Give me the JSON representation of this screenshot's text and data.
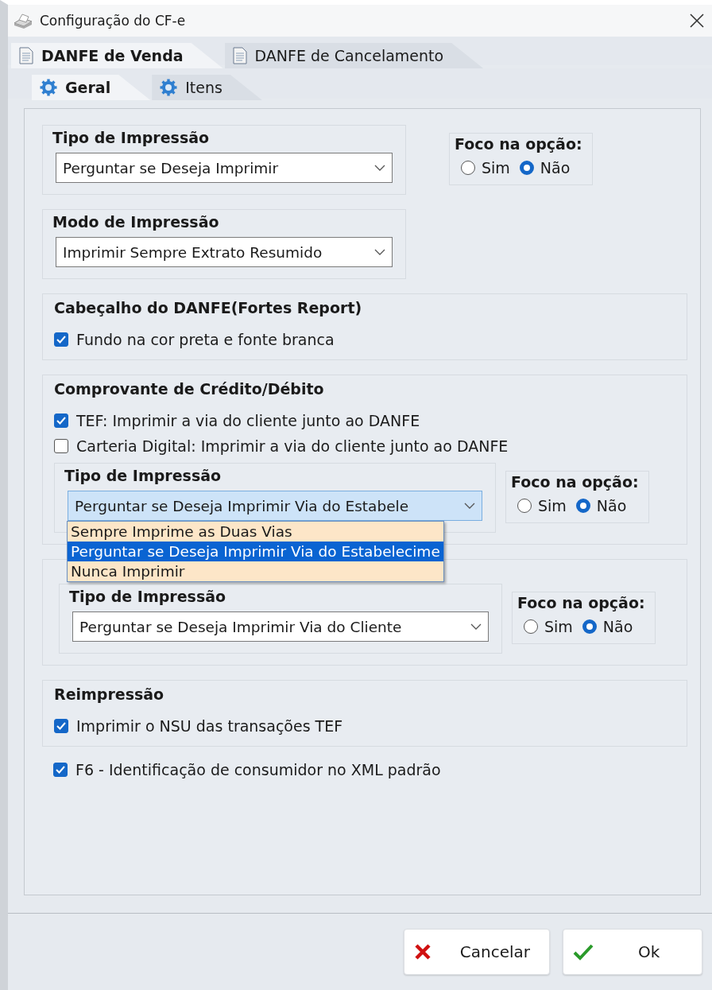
{
  "window": {
    "title": "Configuração do CF-e"
  },
  "tabs": [
    {
      "label": "DANFE de Venda",
      "selected": true
    },
    {
      "label": "DANFE de Cancelamento",
      "selected": false
    }
  ],
  "subtabs": [
    {
      "label": "Geral",
      "selected": true
    },
    {
      "label": "Itens",
      "selected": false
    }
  ],
  "sections": [
    {
      "kind": "row",
      "row": {
        "title": "Tipo de Impressão",
        "select": {
          "value": "Perguntar se Deseja Imprimir",
          "focused": false
        },
        "focus": {
          "title": "Foco na opção:",
          "options": [
            {
              "label": "Sim",
              "selected": false
            },
            {
              "label": "Não",
              "selected": true
            }
          ]
        }
      }
    },
    {
      "kind": "row",
      "row": {
        "title": "Modo de Impressão",
        "select": {
          "value": "Imprimir Sempre Extrato Resumido",
          "focused": false
        }
      }
    },
    {
      "kind": "group",
      "title": "Cabeçalho do DANFE(Fortes Report)",
      "checks": [
        {
          "label": "Fundo na cor preta e fonte branca",
          "checked": true
        }
      ]
    },
    {
      "kind": "group",
      "title": "Comprovante de Crédito/Débito",
      "checks": [
        {
          "label": "TEF: Imprimir a via do cliente junto ao DANFE",
          "checked": true
        },
        {
          "label": "Carteria Digital: Imprimir a via do cliente junto ao DANFE",
          "checked": false
        }
      ],
      "row": {
        "title": "Tipo de Impressão",
        "select": {
          "value": "Perguntar se Deseja Imprimir Via do Estabele",
          "focused": true,
          "options": [
            {
              "label": "Sempre Imprime as Duas Vias",
              "selected": false
            },
            {
              "label": "Perguntar se Deseja Imprimir Via do Estabelecime",
              "selected": true
            },
            {
              "label": "Nunca Imprimir",
              "selected": false
            }
          ]
        },
        "focus": {
          "title": "Foco na opção:",
          "options": [
            {
              "label": "Sim",
              "selected": false
            },
            {
              "label": "Não",
              "selected": true
            }
          ]
        }
      }
    },
    {
      "kind": "group",
      "row": {
        "title": "Tipo de Impressão",
        "select": {
          "value": "Perguntar se Deseja Imprimir Via do Cliente",
          "focused": false
        },
        "focus": {
          "title": "Foco na opção:",
          "options": [
            {
              "label": "Sim",
              "selected": false
            },
            {
              "label": "Não",
              "selected": true
            }
          ]
        }
      }
    },
    {
      "kind": "group",
      "title": "Reimpressão",
      "checks": [
        {
          "label": "Imprimir o NSU das transações TEF",
          "checked": true
        }
      ]
    },
    {
      "kind": "check",
      "checks": [
        {
          "label": "F6 - Identificação de consumidor no XML padrão",
          "checked": true
        }
      ]
    }
  ],
  "buttons": [
    {
      "label": "Cancelar",
      "kind": "cancel"
    },
    {
      "label": "Ok",
      "kind": "ok"
    }
  ]
}
